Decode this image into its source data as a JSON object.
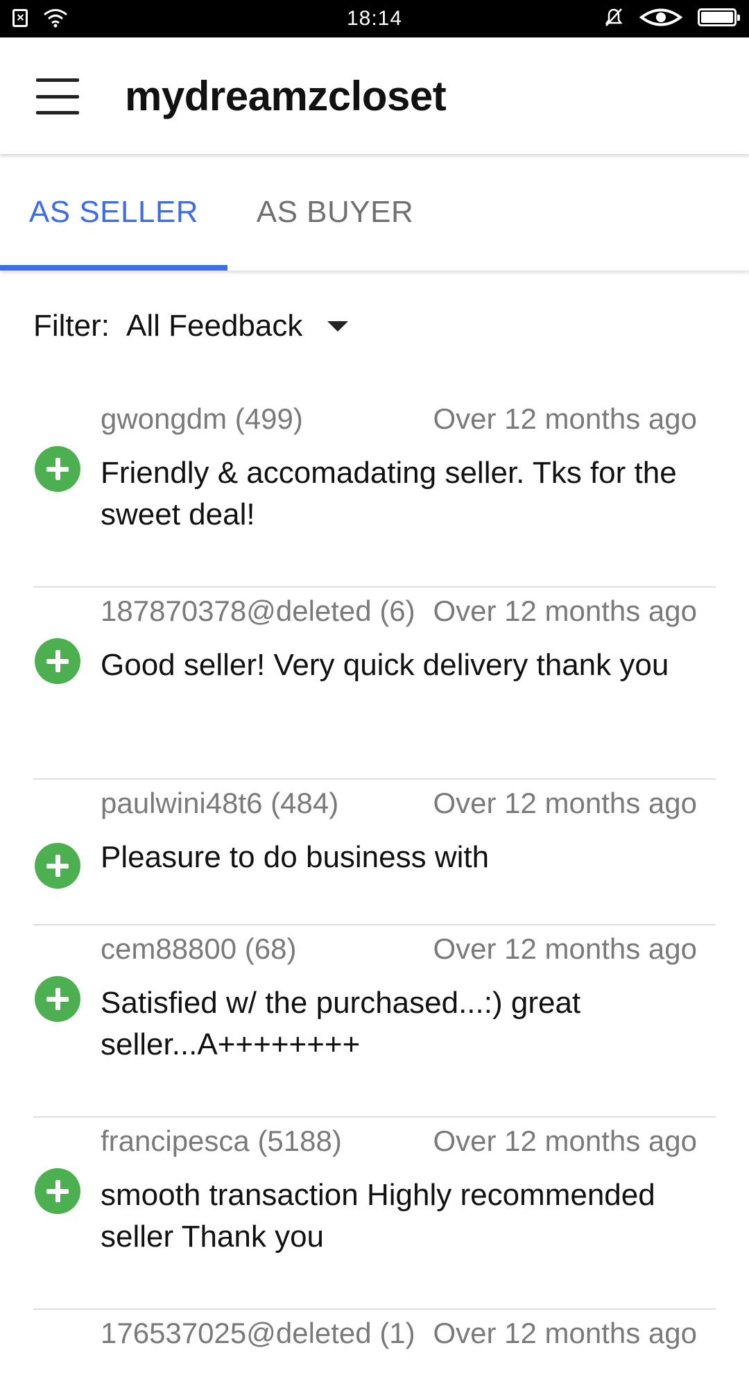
{
  "status_bar": {
    "time": "18:14",
    "left_icons": [
      "sim-off-icon",
      "wifi-icon"
    ],
    "right_icons": [
      "notifications-off-icon",
      "eye-icon",
      "battery-icon"
    ]
  },
  "app_bar": {
    "title": "mydreamzcloset",
    "menu_icon": "hamburger-menu-icon"
  },
  "tabs": [
    {
      "label": "AS SELLER",
      "selected": true
    },
    {
      "label": "AS BUYER",
      "selected": false
    }
  ],
  "filter": {
    "label": "Filter:",
    "value": "All Feedback"
  },
  "colors": {
    "accent": "#3d6ce8",
    "positive": "#4caf50",
    "muted_text": "#7a7a7a",
    "divider": "#dedede"
  },
  "feedback": [
    {
      "user": "gwongdm (499)",
      "time": "Over 12 months ago",
      "comment": "Friendly & accomadating seller. Tks for the sweet deal!",
      "icon": "positive-plus-icon"
    },
    {
      "user": "187870378@deleted (6)",
      "time": "Over 12 months ago",
      "comment": "Good seller! Very quick delivery thank you",
      "icon": "positive-plus-icon"
    },
    {
      "user": "paulwini48t6 (484)",
      "time": "Over 12 months ago",
      "comment": "Pleasure to do business with",
      "icon": "positive-plus-icon"
    },
    {
      "user": "cem88800 (68)",
      "time": "Over 12 months ago",
      "comment": "Satisfied w/ the  purchased...:) great seller...A++++++++",
      "icon": "positive-plus-icon"
    },
    {
      "user": "francipesca (5188)",
      "time": "Over 12 months ago",
      "comment": "smooth transaction Highly recommended seller  Thank you",
      "icon": "positive-plus-icon"
    },
    {
      "user": "176537025@deleted (1)",
      "time": "Over 12 months ago",
      "comment": "",
      "icon": "positive-plus-icon"
    }
  ]
}
